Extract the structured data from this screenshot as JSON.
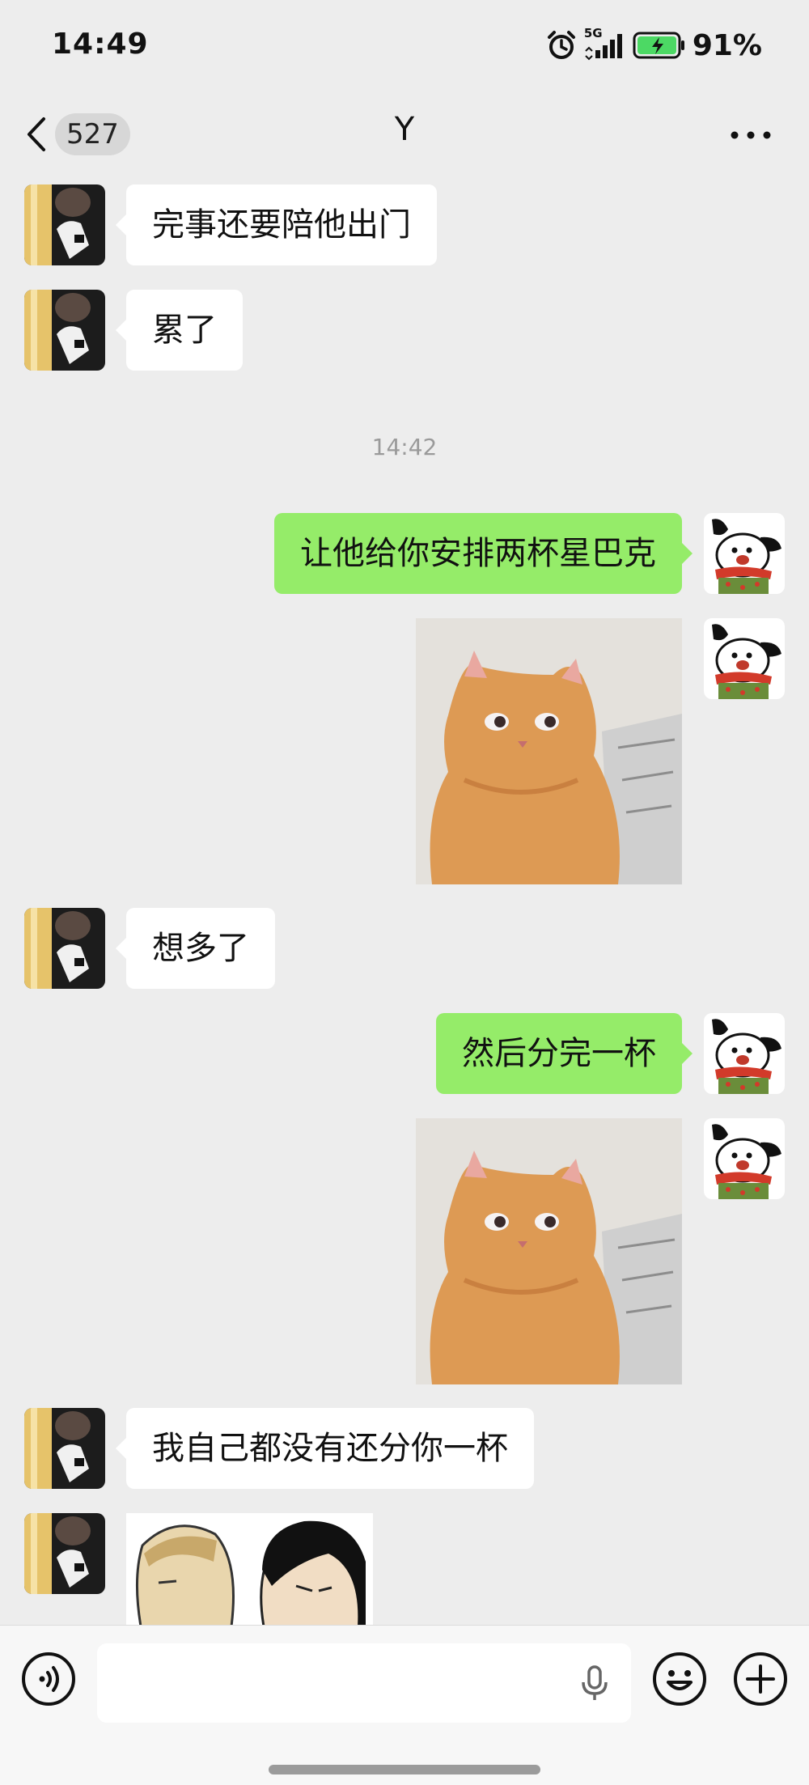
{
  "status_bar": {
    "time": "14:49",
    "network": "5G",
    "battery_percent": "91%",
    "icons": [
      "alarm-icon",
      "signal-icon",
      "battery-charging-icon"
    ]
  },
  "header": {
    "unread_count": "527",
    "title": "Y",
    "icons": [
      "back-chevron-icon",
      "more-icon"
    ]
  },
  "messages": {
    "m1": {
      "side": "left",
      "text": "完事还要陪他出门"
    },
    "m2": {
      "side": "left",
      "text": "累了"
    },
    "time_divider": "14:42",
    "m3": {
      "side": "right",
      "text": "让他给你安排两杯星巴克"
    },
    "m4": {
      "side": "right",
      "type": "sticker",
      "sticker": "orange-cat-sticker"
    },
    "m5": {
      "side": "left",
      "text": "想多了"
    },
    "m6": {
      "side": "right",
      "text": "然后分完一杯"
    },
    "m7": {
      "side": "right",
      "type": "sticker",
      "sticker": "orange-cat-sticker"
    },
    "m8": {
      "side": "left",
      "text": "我自己都没有还分你一杯"
    },
    "m9": {
      "side": "left",
      "type": "image",
      "image": "comic-two-people"
    }
  },
  "input_bar": {
    "placeholder": "",
    "icons": [
      "voice-mode-icon",
      "microphone-icon",
      "emoji-icon",
      "plus-icon"
    ]
  },
  "colors": {
    "background": "#ededed",
    "sent_bubble": "#95ec69",
    "received_bubble": "#ffffff",
    "battery_fill": "#4cd964"
  }
}
